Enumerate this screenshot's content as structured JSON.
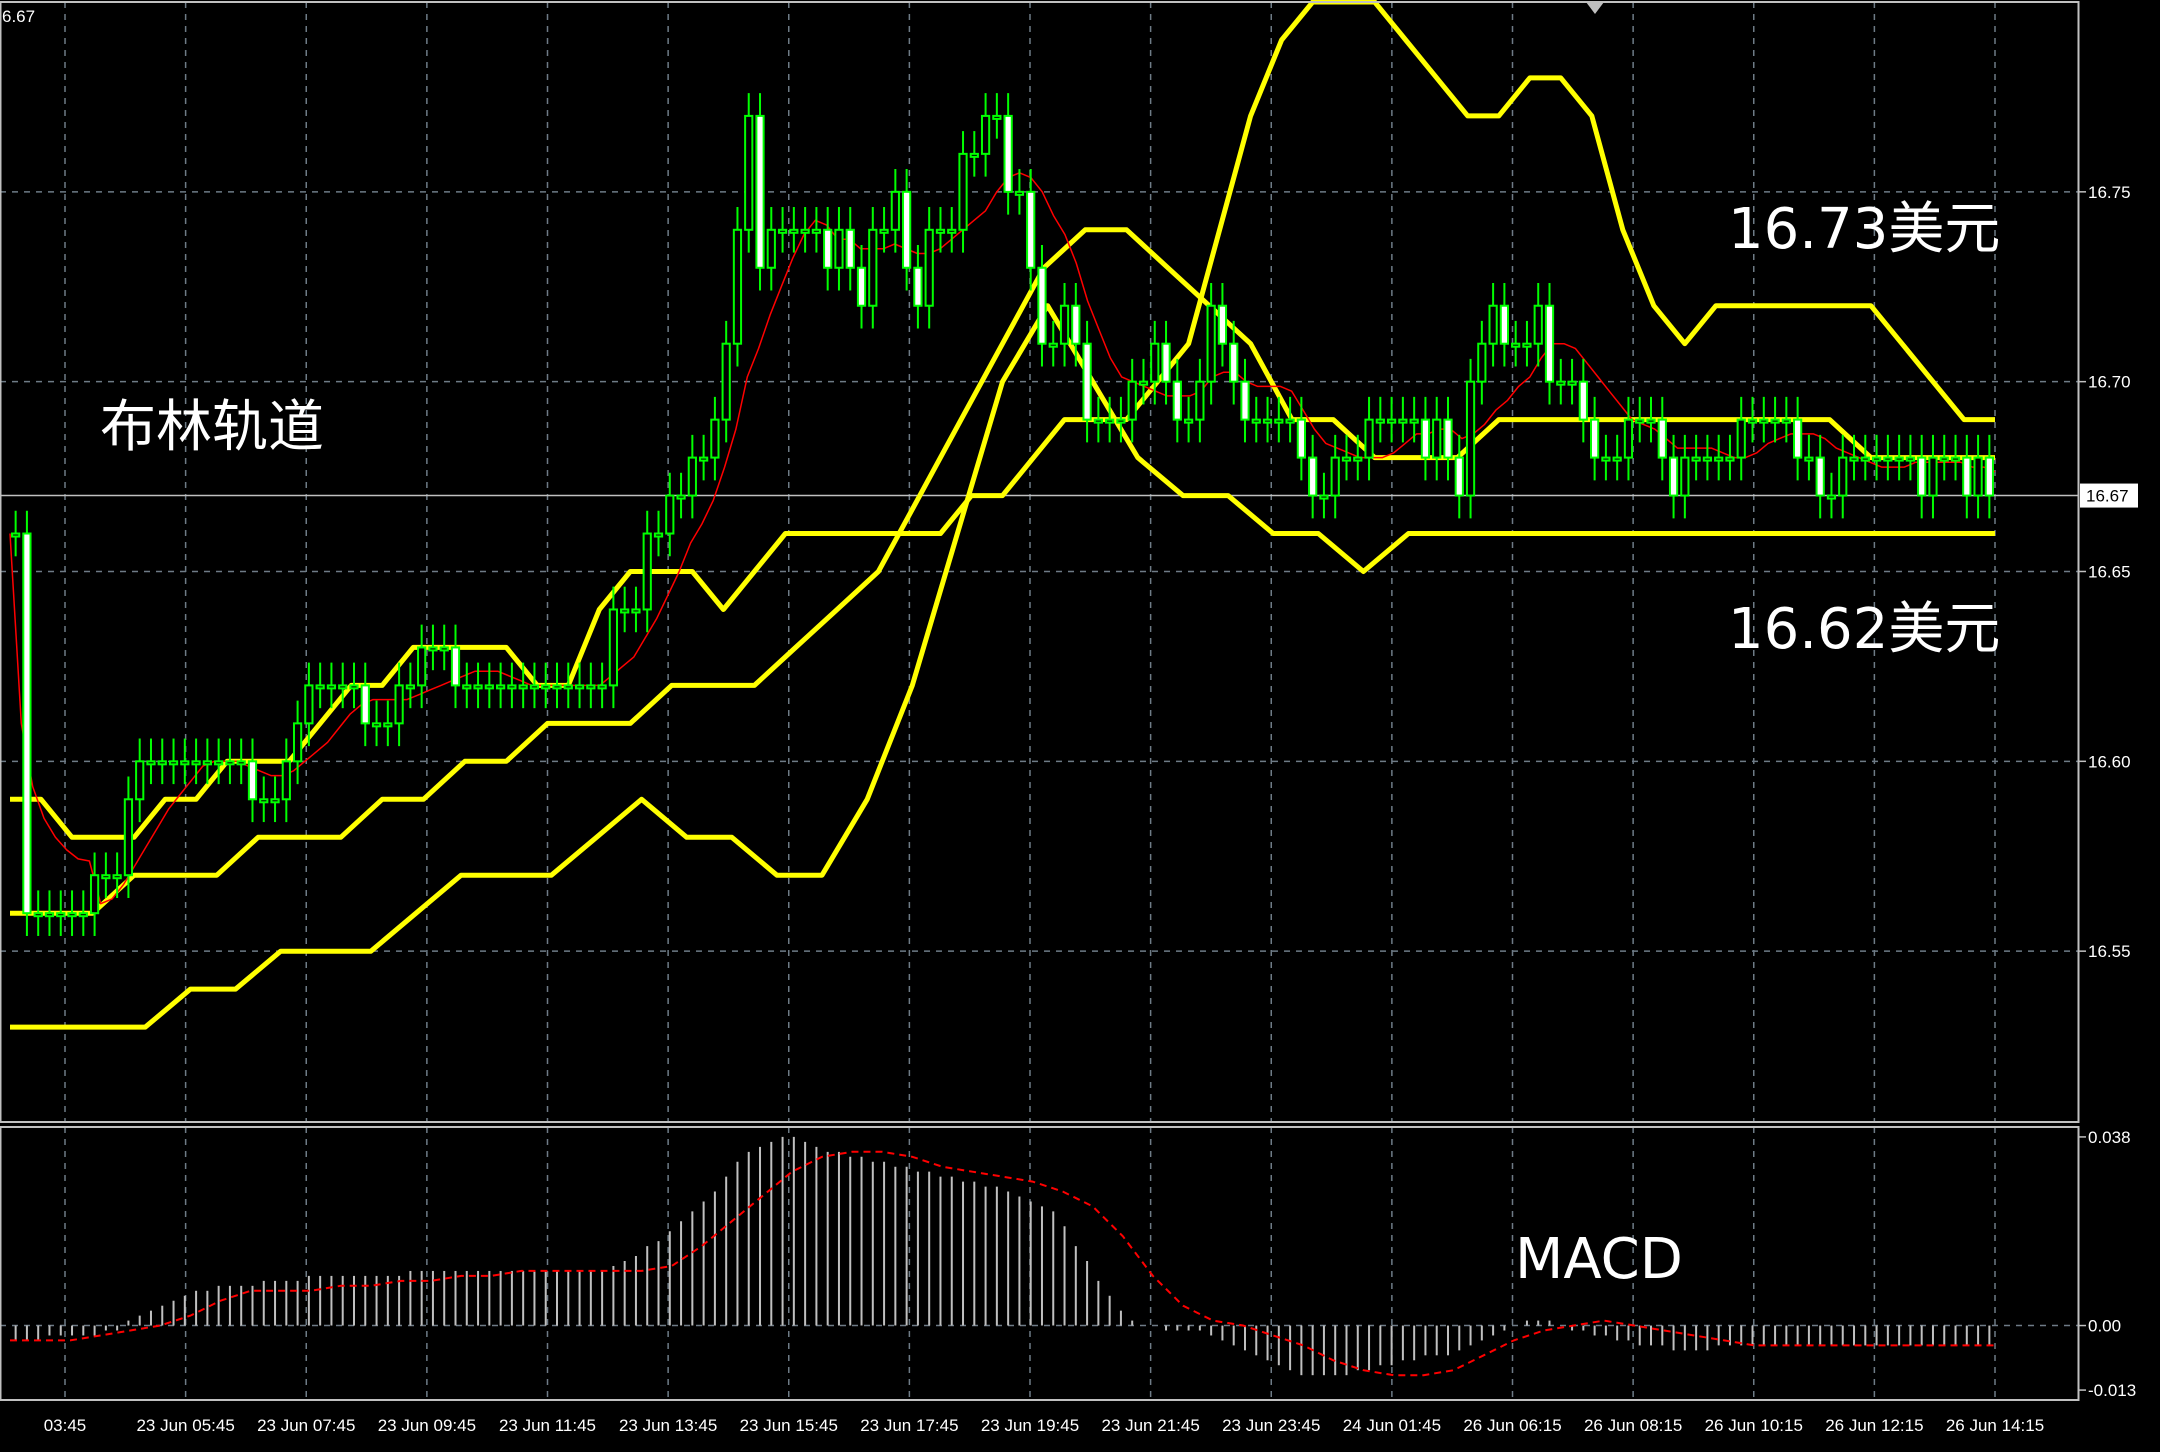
{
  "chart_data": [
    {
      "type": "candlestick",
      "top_left_label": "6.67",
      "current_price_label": "16.67",
      "ylim": [
        16.505,
        16.8
      ],
      "y_ticks": [
        "16.75",
        "16.70",
        "16.65",
        "16.60",
        "16.55"
      ],
      "x_ticks": [
        "03:45",
        "23 Jun 05:45",
        "23 Jun 07:45",
        "23 Jun 09:45",
        "23 Jun 11:45",
        "23 Jun 13:45",
        "23 Jun 15:45",
        "23 Jun 17:45",
        "23 Jun 19:45",
        "23 Jun 21:45",
        "23 Jun 23:45",
        "24 Jun 01:45",
        "26 Jun 06:15",
        "26 Jun 08:15",
        "26 Jun 10:15",
        "26 Jun 12:15",
        "26 Jun 14:15"
      ],
      "colors": {
        "candle": "#00ff00",
        "bollinger": "#ffff00",
        "moving_average": "#ff0000",
        "grid": "#6e7b86",
        "price_line": "#c0c0c0"
      },
      "annotations": [
        "布林轨道",
        "16.73美元",
        "16.62美元"
      ],
      "closes": [
        16.66,
        16.56,
        16.56,
        16.56,
        16.56,
        16.56,
        16.56,
        16.57,
        16.57,
        16.57,
        16.59,
        16.6,
        16.6,
        16.6,
        16.6,
        16.6,
        16.6,
        16.6,
        16.6,
        16.6,
        16.6,
        16.59,
        16.59,
        16.59,
        16.6,
        16.61,
        16.62,
        16.62,
        16.62,
        16.62,
        16.62,
        16.61,
        16.61,
        16.61,
        16.62,
        16.62,
        16.63,
        16.63,
        16.63,
        16.62,
        16.62,
        16.62,
        16.62,
        16.62,
        16.62,
        16.62,
        16.62,
        16.62,
        16.62,
        16.62,
        16.62,
        16.62,
        16.62,
        16.64,
        16.64,
        16.64,
        16.66,
        16.66,
        16.67,
        16.67,
        16.68,
        16.68,
        16.69,
        16.71,
        16.74,
        16.77,
        16.73,
        16.74,
        16.74,
        16.74,
        16.74,
        16.74,
        16.73,
        16.74,
        16.73,
        16.72,
        16.74,
        16.74,
        16.75,
        16.73,
        16.72,
        16.74,
        16.74,
        16.74,
        16.76,
        16.76,
        16.77,
        16.77,
        16.75,
        16.75,
        16.73,
        16.71,
        16.71,
        16.72,
        16.71,
        16.69,
        16.69,
        16.69,
        16.69,
        16.7,
        16.7,
        16.71,
        16.7,
        16.69,
        16.69,
        16.7,
        16.72,
        16.71,
        16.7,
        16.69,
        16.69,
        16.69,
        16.69,
        16.69,
        16.68,
        16.67,
        16.67,
        16.68,
        16.68,
        16.68,
        16.69,
        16.69,
        16.69,
        16.69,
        16.69,
        16.68,
        16.69,
        16.68,
        16.67,
        16.7,
        16.71,
        16.72,
        16.71,
        16.71,
        16.71,
        16.72,
        16.7,
        16.7,
        16.7,
        16.69,
        16.68,
        16.68,
        16.68,
        16.69,
        16.69,
        16.69,
        16.68,
        16.67,
        16.68,
        16.68,
        16.68,
        16.68,
        16.68,
        16.69,
        16.69,
        16.69,
        16.69,
        16.69,
        16.68,
        16.68,
        16.67,
        16.67,
        16.68,
        16.68,
        16.68,
        16.68,
        16.68,
        16.68,
        16.68,
        16.67,
        16.68,
        16.68,
        16.68,
        16.67,
        16.68,
        16.67
      ],
      "bollinger_upper": [
        16.59,
        16.59,
        16.58,
        16.58,
        16.58,
        16.59,
        16.59,
        16.6,
        16.6,
        16.6,
        16.61,
        16.62,
        16.62,
        16.63,
        16.63,
        16.63,
        16.63,
        16.62,
        16.62,
        16.64,
        16.65,
        16.65,
        16.65,
        16.64,
        16.65,
        16.66,
        16.66,
        16.66,
        16.66,
        16.66,
        16.66,
        16.67,
        16.67,
        16.68,
        16.69,
        16.69,
        16.69,
        16.7,
        16.71,
        16.74,
        16.77,
        16.79,
        16.8,
        16.8,
        16.8,
        16.79,
        16.78,
        16.77,
        16.77,
        16.78,
        16.78,
        16.77,
        16.74,
        16.72,
        16.71,
        16.72,
        16.72,
        16.72,
        16.72,
        16.72,
        16.72,
        16.71,
        16.7,
        16.69,
        16.69
      ],
      "bollinger_middle": [
        16.56,
        16.56,
        16.56,
        16.57,
        16.57,
        16.57,
        16.58,
        16.58,
        16.58,
        16.59,
        16.59,
        16.6,
        16.6,
        16.61,
        16.61,
        16.61,
        16.62,
        16.62,
        16.62,
        16.63,
        16.64,
        16.65,
        16.67,
        16.69,
        16.71,
        16.73,
        16.74,
        16.74,
        16.73,
        16.72,
        16.71,
        16.69,
        16.69,
        16.68,
        16.68,
        16.68,
        16.69,
        16.69,
        16.69,
        16.69,
        16.69,
        16.69,
        16.69,
        16.69,
        16.69,
        16.68,
        16.68,
        16.68,
        16.68
      ],
      "bollinger_lower": [
        16.53,
        16.53,
        16.53,
        16.53,
        16.54,
        16.54,
        16.55,
        16.55,
        16.55,
        16.56,
        16.57,
        16.57,
        16.57,
        16.58,
        16.59,
        16.58,
        16.58,
        16.57,
        16.57,
        16.59,
        16.62,
        16.66,
        16.7,
        16.72,
        16.7,
        16.68,
        16.67,
        16.67,
        16.66,
        16.66,
        16.65,
        16.66,
        16.66,
        16.66,
        16.66,
        16.66,
        16.66,
        16.66,
        16.66,
        16.66,
        16.66,
        16.66,
        16.66,
        16.66,
        16.66
      ]
    },
    {
      "type": "histogram",
      "title": "MACD",
      "ylim": [
        -0.015,
        0.04
      ],
      "y_ticks": [
        "0.038",
        "0.00",
        "-0.013"
      ],
      "colors": {
        "histogram": "#c0c0c0",
        "signal": "#ff0000"
      },
      "histogram": [
        -0.003,
        -0.003,
        -0.003,
        -0.002,
        -0.002,
        -0.002,
        -0.002,
        -0.002,
        -0.001,
        -0.001,
        0.001,
        0.002,
        0.003,
        0.004,
        0.005,
        0.006,
        0.007,
        0.007,
        0.008,
        0.008,
        0.008,
        0.008,
        0.009,
        0.009,
        0.009,
        0.009,
        0.01,
        0.01,
        0.01,
        0.01,
        0.01,
        0.01,
        0.01,
        0.01,
        0.01,
        0.011,
        0.011,
        0.011,
        0.011,
        0.011,
        0.011,
        0.011,
        0.011,
        0.011,
        0.011,
        0.011,
        0.011,
        0.011,
        0.011,
        0.011,
        0.011,
        0.011,
        0.011,
        0.012,
        0.013,
        0.014,
        0.016,
        0.017,
        0.019,
        0.021,
        0.023,
        0.025,
        0.027,
        0.03,
        0.033,
        0.035,
        0.036,
        0.037,
        0.038,
        0.038,
        0.037,
        0.036,
        0.035,
        0.035,
        0.034,
        0.034,
        0.033,
        0.033,
        0.032,
        0.032,
        0.031,
        0.031,
        0.03,
        0.03,
        0.029,
        0.029,
        0.028,
        0.028,
        0.027,
        0.026,
        0.025,
        0.024,
        0.023,
        0.02,
        0.016,
        0.013,
        0.009,
        0.006,
        0.003,
        0.001,
        0.0,
        0.0,
        -0.001,
        -0.001,
        -0.001,
        -0.001,
        -0.002,
        -0.003,
        -0.004,
        -0.005,
        -0.006,
        -0.007,
        -0.008,
        -0.009,
        -0.01,
        -0.01,
        -0.01,
        -0.01,
        -0.01,
        -0.009,
        -0.009,
        -0.008,
        -0.008,
        -0.007,
        -0.007,
        -0.006,
        -0.006,
        -0.006,
        -0.005,
        -0.004,
        -0.003,
        -0.002,
        -0.001,
        0.0,
        0.001,
        0.001,
        0.001,
        0.0,
        -0.001,
        -0.001,
        -0.002,
        -0.002,
        -0.003,
        -0.003,
        -0.004,
        -0.004,
        -0.004,
        -0.005,
        -0.005,
        -0.005,
        -0.005,
        -0.004,
        -0.004,
        -0.004,
        -0.004,
        -0.004,
        -0.004,
        -0.004,
        -0.004,
        -0.004,
        -0.004,
        -0.004,
        -0.004,
        -0.004,
        -0.004,
        -0.004,
        -0.004,
        -0.004,
        -0.004,
        -0.004,
        -0.004,
        -0.004,
        -0.004,
        -0.004,
        -0.004,
        -0.004
      ],
      "signal": [
        -0.003,
        -0.003,
        -0.003,
        -0.002,
        -0.001,
        0.0,
        0.002,
        0.005,
        0.007,
        0.007,
        0.007,
        0.008,
        0.008,
        0.009,
        0.009,
        0.01,
        0.01,
        0.011,
        0.011,
        0.011,
        0.011,
        0.011,
        0.012,
        0.016,
        0.021,
        0.026,
        0.031,
        0.034,
        0.035,
        0.035,
        0.034,
        0.032,
        0.031,
        0.03,
        0.029,
        0.027,
        0.024,
        0.018,
        0.01,
        0.004,
        0.001,
        0.0,
        -0.002,
        -0.004,
        -0.007,
        -0.009,
        -0.01,
        -0.01,
        -0.009,
        -0.006,
        -0.003,
        -0.001,
        0.0,
        0.001,
        0.0,
        -0.001,
        -0.002,
        -0.003,
        -0.004,
        -0.004,
        -0.004,
        -0.004,
        -0.004,
        -0.004,
        -0.004,
        -0.004,
        -0.004
      ]
    }
  ]
}
